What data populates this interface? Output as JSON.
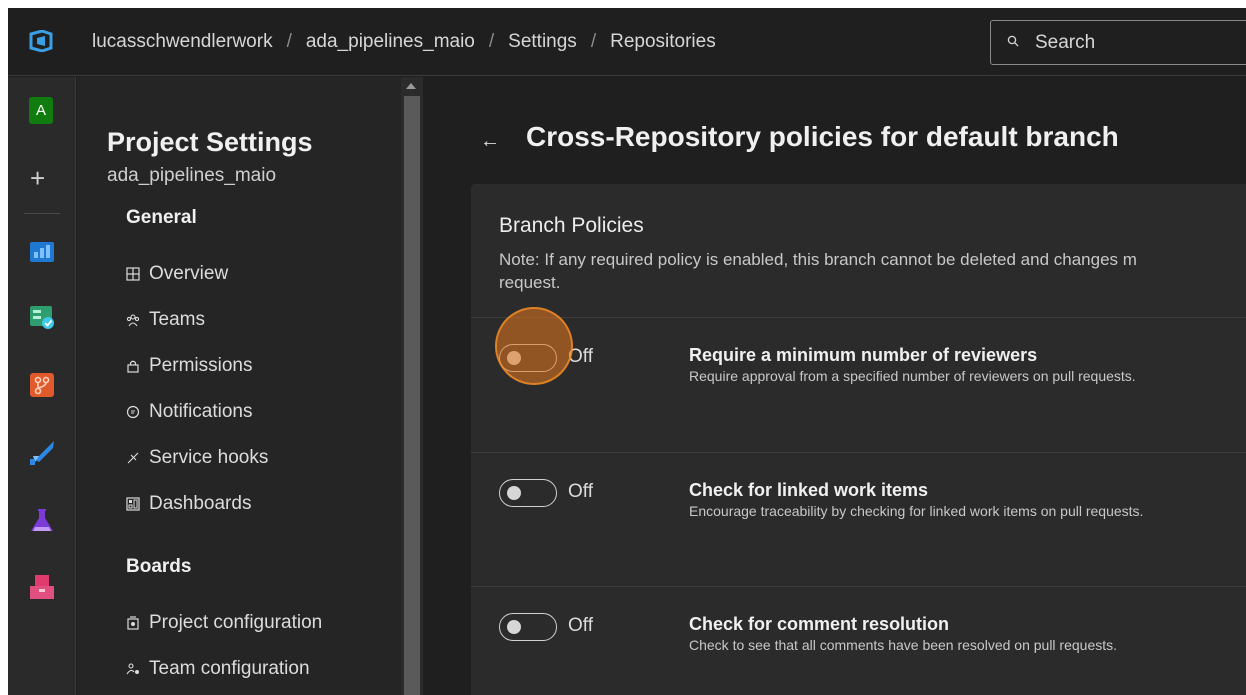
{
  "breadcrumb": {
    "org": "lucasschwendlerwork",
    "project": "ada_pipelines_maio",
    "settings": "Settings",
    "page": "Repositories",
    "separator": "/"
  },
  "search": {
    "placeholder": "Search"
  },
  "rail": {
    "avatar_letter": "A",
    "add_glyph": "+",
    "services": [
      "overview-service-icon",
      "boards-service-icon",
      "repos-service-icon",
      "pipelines-service-icon",
      "test-plans-service-icon",
      "artifacts-service-icon"
    ]
  },
  "sidebar": {
    "title": "Project Settings",
    "subtitle": "ada_pipelines_maio",
    "general_header": "General",
    "general_items": [
      {
        "label": "Overview",
        "icon": "overview-icon"
      },
      {
        "label": "Teams",
        "icon": "teams-icon"
      },
      {
        "label": "Permissions",
        "icon": "lock-icon"
      },
      {
        "label": "Notifications",
        "icon": "chat-icon"
      },
      {
        "label": "Service hooks",
        "icon": "hook-icon"
      },
      {
        "label": "Dashboards",
        "icon": "dashboard-icon"
      }
    ],
    "boards_header": "Boards",
    "boards_items": [
      {
        "label": "Project configuration",
        "icon": "project-config-icon"
      },
      {
        "label": "Team configuration",
        "icon": "team-config-icon"
      }
    ]
  },
  "main": {
    "back_glyph": "←",
    "title": "Cross-Repository policies for default branch",
    "card": {
      "title": "Branch Policies",
      "note_line1": "Note: If any required policy is enabled, this branch cannot be deleted and changes m",
      "note_line2": "request."
    },
    "policies": [
      {
        "state": "Off",
        "title": "Require a minimum number of reviewers",
        "desc": "Require approval from a specified number of reviewers on pull requests."
      },
      {
        "state": "Off",
        "title": "Check for linked work items",
        "desc": "Encourage traceability by checking for linked work items on pull requests."
      },
      {
        "state": "Off",
        "title": "Check for comment resolution",
        "desc": "Check to see that all comments have been resolved on pull requests."
      }
    ]
  },
  "colors": {
    "background": "#1f1f1f",
    "card": "#2b2b2b",
    "sidebar": "#252526",
    "highlight": "#e6781e",
    "avatar": "#107c10"
  }
}
